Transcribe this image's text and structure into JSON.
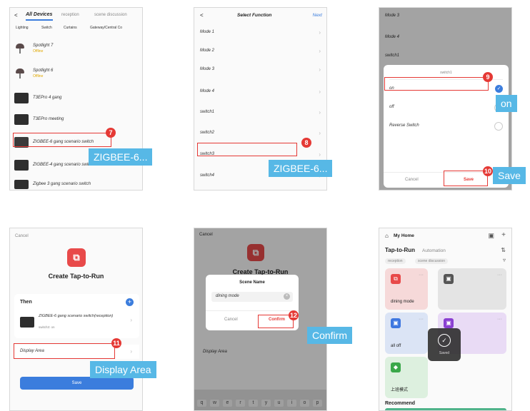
{
  "s1": {
    "back": "<",
    "tabs": [
      "All Devices",
      "reception",
      "scene discussion"
    ],
    "subtabs": [
      "Lighting",
      "Switch",
      "Curtains",
      "Gateway/Central Co"
    ],
    "devices": [
      {
        "name": "Spotlight 7",
        "status": "Offline"
      },
      {
        "name": "Spotlight 6",
        "status": "Offline"
      },
      {
        "name": "T3EPro 4 gang",
        "status": ""
      },
      {
        "name": "T3EPro meeting",
        "status": ""
      },
      {
        "name": "ZIGBEE-6 gang scenario switch",
        "status": ""
      },
      {
        "name": "ZIGBEE-4 gang scenario switch",
        "status": ""
      },
      {
        "name": "Zigbee 3 gang scenario switch",
        "status": ""
      }
    ],
    "step": "7",
    "callout": "ZIGBEE-6..."
  },
  "s2": {
    "back": "<",
    "title": "Select Function",
    "next": "Next",
    "items": [
      "Mode 1",
      "Mode 2",
      "Mode 3",
      "Mode 4",
      "switch1",
      "switch2",
      "switch3",
      "switch4"
    ],
    "step": "8",
    "callout": "ZIGBEE-6..."
  },
  "s3": {
    "bg_items": [
      "Mode 3",
      "Mode 4",
      "switch1"
    ],
    "dialog_title": "switch1",
    "options": [
      "on",
      "off",
      "Reverse Switch"
    ],
    "cancel": "Cancel",
    "save": "Save",
    "step_on": "9",
    "step_save": "10",
    "callout_on": "on",
    "callout_save": "Save"
  },
  "s4": {
    "cancel": "Cancel",
    "title": "Create Tap-to-Run",
    "then": "Then",
    "device_name": "ZIGBEE-6 gang scenario switch(reception)",
    "device_sub": "switch3: on",
    "display_area": "Display Area",
    "save": "Save",
    "step": "11",
    "callout": "Display Area"
  },
  "s5": {
    "cancel": "Cancel",
    "bg_title": "Create Tap-to-Run",
    "dialog_title": "Scene Name",
    "input_value": "dining mode",
    "cancel_btn": "Cancel",
    "confirm_btn": "Confirm",
    "display_area": "Display Area",
    "step": "12",
    "callout": "Confirm",
    "keys": [
      "q",
      "w",
      "e",
      "r",
      "t",
      "y",
      "u",
      "i",
      "o",
      "p"
    ]
  },
  "s6": {
    "home": "My Home",
    "tab_active": "Tap-to-Run",
    "tab_other": "Automation",
    "chips": [
      "reception",
      "scene discussion"
    ],
    "tiles": [
      {
        "label": "dining mode",
        "color": "#e84a4a",
        "bg": "#f6d9d9"
      },
      {
        "label": "",
        "color": "#555555",
        "bg": "#e4e4e4"
      },
      {
        "label": "all off",
        "color": "#3f78e0",
        "bg": "#dbe4f5"
      },
      {
        "label": "",
        "color": "#8a3fd1",
        "bg": "#e9dbf5"
      },
      {
        "label": "上班模式",
        "color": "#3aa84a",
        "bg": "#ddf0df"
      }
    ],
    "toast": "Saved",
    "recommend": "Recommend"
  },
  "colors": {
    "accent": "#3b7ddd",
    "step": "#e53935",
    "callout": "#57b8e6"
  }
}
